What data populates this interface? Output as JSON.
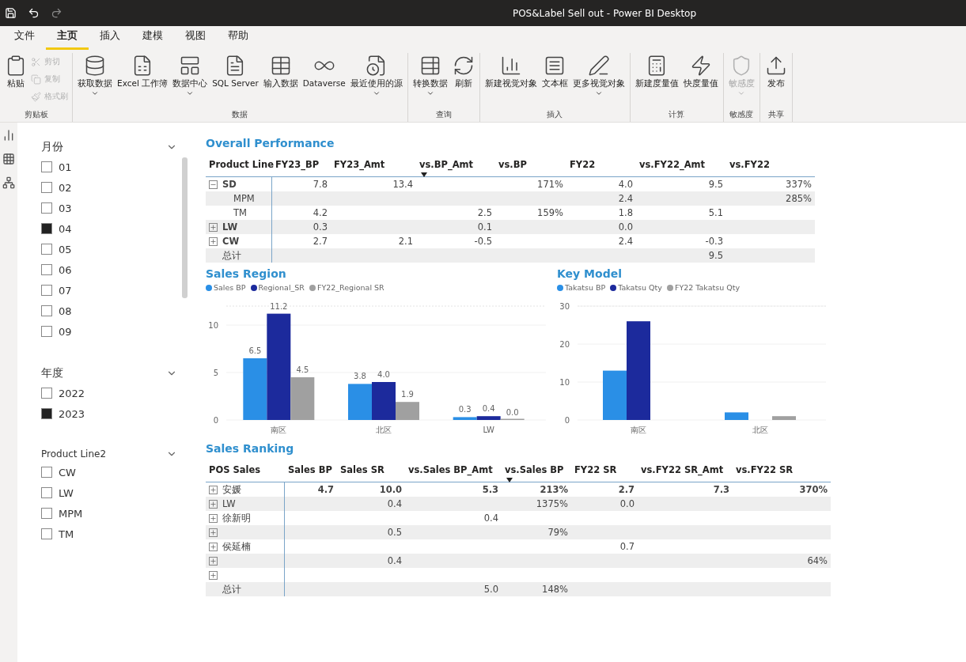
{
  "window": {
    "title": "POS&Label Sell out - Power BI Desktop"
  },
  "menu_tabs": [
    {
      "label": "文件",
      "selected": false
    },
    {
      "label": "主页",
      "selected": true
    },
    {
      "label": "插入",
      "selected": false
    },
    {
      "label": "建模",
      "selected": false
    },
    {
      "label": "视图",
      "selected": false
    },
    {
      "label": "帮助",
      "selected": false
    }
  ],
  "ribbon": [
    {
      "group": "剪贴板",
      "buttons": [
        {
          "label": "粘贴",
          "kind": "large",
          "disabled": false,
          "dropdown": false
        },
        {
          "label": "剪切",
          "kind": "small",
          "disabled": true,
          "dropdown": false
        },
        {
          "label": "复制",
          "kind": "small",
          "disabled": true,
          "dropdown": false
        },
        {
          "label": "格式刷",
          "kind": "small",
          "disabled": true,
          "dropdown": false
        }
      ]
    },
    {
      "group": "数据",
      "buttons": [
        {
          "label": "获取数据",
          "kind": "large",
          "disabled": false,
          "dropdown": true
        },
        {
          "label": "Excel 工作簿",
          "kind": "large",
          "disabled": false,
          "dropdown": false
        },
        {
          "label": "数据中心",
          "kind": "large",
          "disabled": false,
          "dropdown": true
        },
        {
          "label": "SQL Server",
          "kind": "large",
          "disabled": false,
          "dropdown": false
        },
        {
          "label": "输入数据",
          "kind": "large",
          "disabled": false,
          "dropdown": false
        },
        {
          "label": "Dataverse",
          "kind": "large",
          "disabled": false,
          "dropdown": false
        },
        {
          "label": "最近使用的源",
          "kind": "large",
          "disabled": false,
          "dropdown": true
        }
      ]
    },
    {
      "group": "查询",
      "buttons": [
        {
          "label": "转换数据",
          "kind": "large",
          "disabled": false,
          "dropdown": true
        },
        {
          "label": "刷新",
          "kind": "large",
          "disabled": false,
          "dropdown": false
        }
      ]
    },
    {
      "group": "插入",
      "buttons": [
        {
          "label": "新建视觉对象",
          "kind": "large",
          "disabled": false,
          "dropdown": false
        },
        {
          "label": "文本框",
          "kind": "large",
          "disabled": false,
          "dropdown": false
        },
        {
          "label": "更多视觉对象",
          "kind": "large",
          "disabled": false,
          "dropdown": true
        }
      ]
    },
    {
      "group": "计算",
      "buttons": [
        {
          "label": "新建度量值",
          "kind": "large",
          "disabled": false,
          "dropdown": false
        },
        {
          "label": "快度量值",
          "kind": "large",
          "disabled": false,
          "dropdown": false
        }
      ]
    },
    {
      "group": "敏感度",
      "buttons": [
        {
          "label": "敏感度",
          "kind": "large",
          "disabled": true,
          "dropdown": true
        }
      ]
    },
    {
      "group": "共享",
      "buttons": [
        {
          "label": "发布",
          "kind": "large",
          "disabled": false,
          "dropdown": false
        }
      ]
    }
  ],
  "slicers": [
    {
      "title": "月份",
      "items": [
        {
          "label": "01",
          "checked": false
        },
        {
          "label": "02",
          "checked": false
        },
        {
          "label": "03",
          "checked": false
        },
        {
          "label": "04",
          "checked": true
        },
        {
          "label": "05",
          "checked": false
        },
        {
          "label": "06",
          "checked": false
        },
        {
          "label": "07",
          "checked": false
        },
        {
          "label": "08",
          "checked": false
        },
        {
          "label": "09",
          "checked": false
        }
      ]
    },
    {
      "title": "年度",
      "items": [
        {
          "label": "2022",
          "checked": false
        },
        {
          "label": "2023",
          "checked": true
        }
      ]
    },
    {
      "title": "Product Line2",
      "items": [
        {
          "label": "CW",
          "checked": false
        },
        {
          "label": "LW",
          "checked": false
        },
        {
          "label": "MPM",
          "checked": false
        },
        {
          "label": "TM",
          "checked": false
        }
      ]
    }
  ],
  "overall_performance": {
    "title": "Overall Performance",
    "columns": [
      {
        "label": "Product Line",
        "sorted": false
      },
      {
        "label": "FY23_BP",
        "sorted": false
      },
      {
        "label": "FY23_Amt",
        "sorted": false
      },
      {
        "label": "vs.BP_Amt",
        "sorted": true
      },
      {
        "label": "vs.BP",
        "sorted": false
      },
      {
        "label": "FY22",
        "sorted": false
      },
      {
        "label": "vs.FY22_Amt",
        "sorted": false
      },
      {
        "label": "vs.FY22",
        "sorted": false
      }
    ],
    "rows": [
      {
        "kind": "group",
        "expanded": true,
        "cells": [
          "SD",
          "7.8",
          "13.4",
          null,
          "171%",
          "4.0",
          "9.5",
          "337%"
        ]
      },
      {
        "kind": "child",
        "cells": [
          "MPM",
          null,
          null,
          null,
          null,
          "2.4",
          null,
          "285%"
        ]
      },
      {
        "kind": "child",
        "cells": [
          "TM",
          "4.2",
          null,
          "2.5",
          "159%",
          "1.8",
          "5.1",
          null
        ]
      },
      {
        "kind": "group",
        "expanded": false,
        "cells": [
          "LW",
          "0.3",
          null,
          "0.1",
          null,
          "0.0",
          null,
          null
        ]
      },
      {
        "kind": "group",
        "expanded": false,
        "cells": [
          "CW",
          "2.7",
          "2.1",
          "-0.5",
          null,
          "2.4",
          "-0.3",
          null
        ]
      },
      {
        "kind": "total",
        "cells": [
          "总计",
          null,
          null,
          null,
          null,
          null,
          "9.5",
          null
        ]
      }
    ]
  },
  "sales_region": {
    "title": "Sales Region",
    "chart_data": {
      "type": "bar",
      "categories": [
        "南区",
        "北区",
        "LW"
      ],
      "series": [
        {
          "name": "Sales BP",
          "color": "#2a8fe6",
          "values": [
            6.5,
            3.8,
            0.3
          ]
        },
        {
          "name": "Regional_SR",
          "color": "#1c2a9c",
          "values": [
            11.2,
            4.0,
            0.4
          ]
        },
        {
          "name": "FY22_Regional SR",
          "color": "#a0a0a0",
          "values": [
            4.5,
            1.9,
            0.0
          ]
        }
      ],
      "ylim": [
        0,
        12
      ],
      "yticks": [
        0,
        5,
        10
      ],
      "value_labels": [
        [
          "6.5",
          "3.8",
          "0.3"
        ],
        [
          "11.2",
          "4.0",
          "0.4"
        ],
        [
          "4.5",
          "1.9",
          "0.0"
        ]
      ]
    }
  },
  "key_model": {
    "title": "Key Model",
    "chart_data": {
      "type": "bar",
      "categories": [
        "南区",
        "北区"
      ],
      "series": [
        {
          "name": "Takatsu BP",
          "color": "#2a8fe6",
          "values": [
            13,
            2
          ]
        },
        {
          "name": "Takatsu Qty",
          "color": "#1c2a9c",
          "values": [
            26,
            null
          ]
        },
        {
          "name": "FY22 Takatsu Qty",
          "color": "#a0a0a0",
          "values": [
            null,
            1
          ]
        }
      ],
      "ylim": [
        0,
        30
      ],
      "yticks": [
        0,
        10,
        20,
        30
      ]
    }
  },
  "sales_ranking": {
    "title": "Sales Ranking",
    "columns": [
      {
        "label": "POS Sales",
        "sorted": false
      },
      {
        "label": "Sales BP",
        "sorted": false
      },
      {
        "label": "Sales SR",
        "sorted": false
      },
      {
        "label": "vs.Sales BP_Amt",
        "sorted": false
      },
      {
        "label": "vs.Sales BP",
        "sorted": true
      },
      {
        "label": "FY22 SR",
        "sorted": false
      },
      {
        "label": "vs.FY22 SR_Amt",
        "sorted": false
      },
      {
        "label": "vs.FY22 SR",
        "sorted": false
      }
    ],
    "rows": [
      {
        "kind": "group",
        "expanded": false,
        "cells": [
          "安媛",
          "4.7",
          "10.0",
          "5.3",
          "213%",
          "2.7",
          "7.3",
          "370%"
        ]
      },
      {
        "kind": "group",
        "expanded": false,
        "cells": [
          "LW",
          null,
          "0.4",
          null,
          "1375%",
          "0.0",
          null,
          null
        ]
      },
      {
        "kind": "group",
        "expanded": false,
        "cells": [
          "徐新明",
          null,
          null,
          "0.4",
          null,
          null,
          null,
          null
        ]
      },
      {
        "kind": "group",
        "expanded": false,
        "cells": [
          null,
          null,
          "0.5",
          null,
          "79%",
          null,
          null,
          null
        ]
      },
      {
        "kind": "group",
        "expanded": false,
        "cells": [
          "侯延楠",
          null,
          null,
          null,
          null,
          "0.7",
          null,
          null
        ]
      },
      {
        "kind": "group",
        "expanded": false,
        "cells": [
          null,
          null,
          "0.4",
          null,
          null,
          null,
          null,
          "64%"
        ]
      },
      {
        "kind": "group",
        "expanded": false,
        "cells": [
          null,
          null,
          null,
          null,
          null,
          null,
          null,
          null
        ]
      },
      {
        "kind": "total",
        "cells": [
          "总计",
          null,
          null,
          "5.0",
          "148%",
          null,
          null,
          null
        ]
      }
    ]
  }
}
